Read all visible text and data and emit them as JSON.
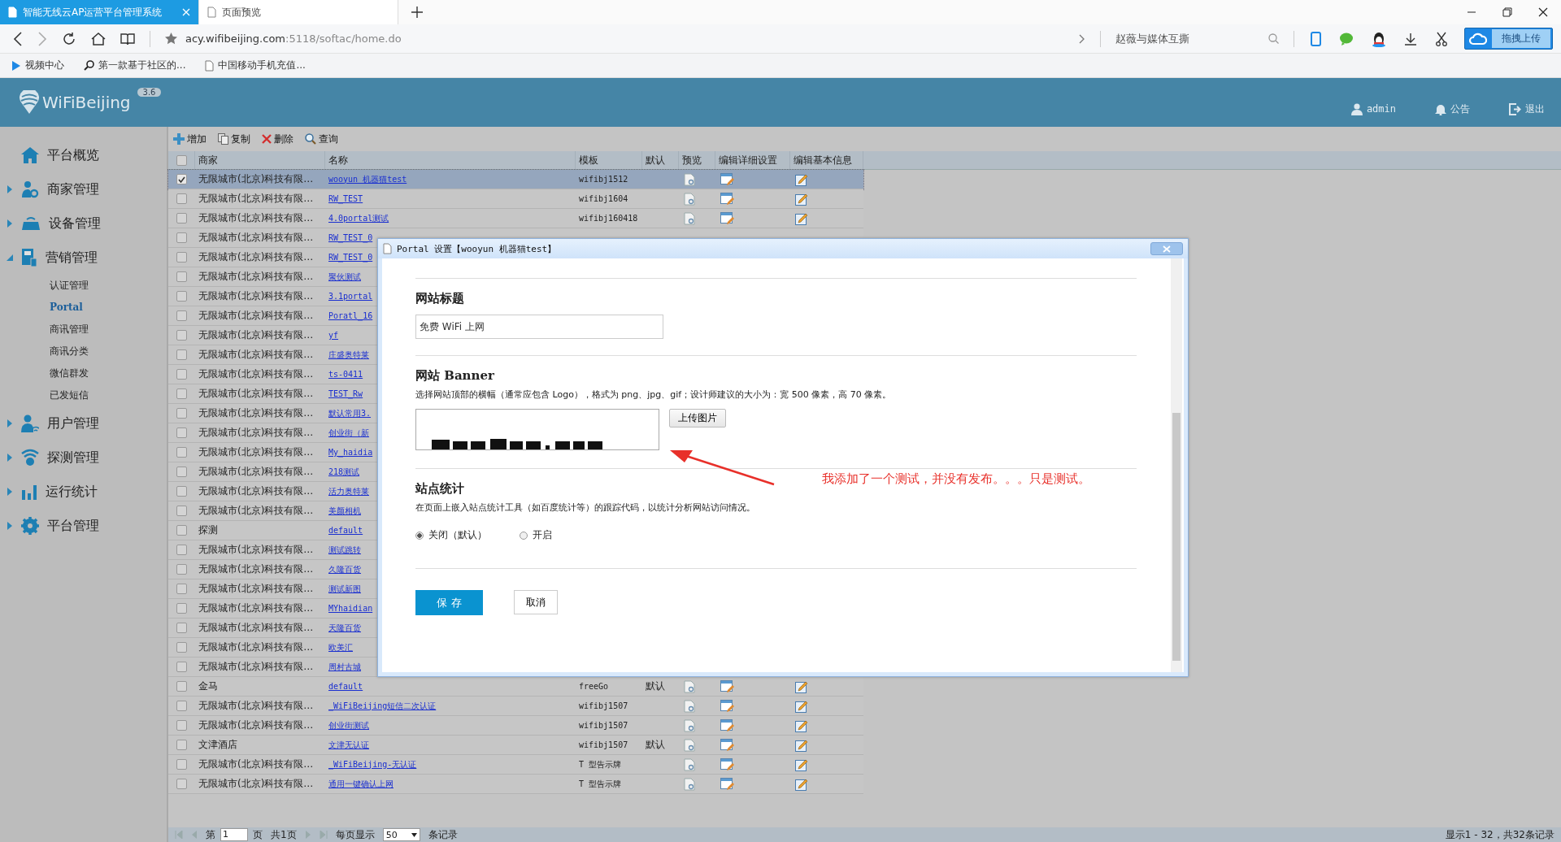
{
  "browser": {
    "tabs": [
      {
        "title": "智能无线云AP运营平台管理系统",
        "selected": true
      },
      {
        "title": "页面预览",
        "selected": false
      }
    ],
    "url_host": "acy.wifibeijing.com",
    "url_path": ":5118/softac/home.do",
    "search_text": "赵薇与媒体互撕",
    "upload_label": "拖拽上传",
    "bookmarks": [
      "视频中心",
      "第一款基于社区的...",
      "中国移动手机充值..."
    ]
  },
  "header": {
    "logo": "WiFiBeijing",
    "version": "3.6",
    "user": "admin",
    "notice": "公告",
    "logout": "退出"
  },
  "sidebar": {
    "items": [
      {
        "label": "平台概览"
      },
      {
        "label": "商家管理",
        "expanded": false
      },
      {
        "label": "设备管理",
        "expanded": false
      },
      {
        "label": "营销管理",
        "expanded": true,
        "children": [
          {
            "label": "认证管理",
            "selected": false
          },
          {
            "label": "Portal",
            "selected": true
          },
          {
            "label": "商讯管理",
            "selected": false
          },
          {
            "label": "商讯分类",
            "selected": false
          },
          {
            "label": "微信群发",
            "selected": false
          },
          {
            "label": "已发短信",
            "selected": false
          }
        ]
      },
      {
        "label": "用户管理",
        "expanded": false
      },
      {
        "label": "探测管理",
        "expanded": false
      },
      {
        "label": "运行统计",
        "expanded": false
      },
      {
        "label": "平台管理",
        "expanded": false
      }
    ]
  },
  "toolbar": [
    "增加",
    "复制",
    "删除",
    "查询"
  ],
  "table": {
    "select_all_checked": false,
    "columns": [
      "商家",
      "名称",
      "模板",
      "默认",
      "预览",
      "编辑详细设置",
      "编辑基本信息"
    ],
    "rows": [
      {
        "merchant": "无限城市(北京)科技有限…",
        "name": "wooyun 机器猫test",
        "template": "wifibj1512",
        "default": "",
        "checked": true,
        "selected": true
      },
      {
        "merchant": "无限城市(北京)科技有限…",
        "name": "RW_TEST",
        "template": "wifibj1604",
        "default": "",
        "checked": false,
        "selected": false
      },
      {
        "merchant": "无限城市(北京)科技有限…",
        "name": "4.0portal测试",
        "template": "wifibj160418",
        "default": "",
        "checked": false,
        "selected": false
      },
      {
        "merchant": "无限城市(北京)科技有限…",
        "name": "RW_TEST_0",
        "checked": false,
        "selected": false
      },
      {
        "merchant": "无限城市(北京)科技有限…",
        "name": "RW_TEST_0",
        "checked": false,
        "selected": false
      },
      {
        "merchant": "无限城市(北京)科技有限…",
        "name": "聚伙测试",
        "checked": false,
        "selected": false
      },
      {
        "merchant": "无限城市(北京)科技有限…",
        "name": "3.1portal",
        "checked": false,
        "selected": false
      },
      {
        "merchant": "无限城市(北京)科技有限…",
        "name": "Poratl_16",
        "checked": false,
        "selected": false
      },
      {
        "merchant": "无限城市(北京)科技有限…",
        "name": "yf",
        "checked": false,
        "selected": false
      },
      {
        "merchant": "无限城市(北京)科技有限…",
        "name": "庄盛奥特莱",
        "checked": false,
        "selected": false
      },
      {
        "merchant": "无限城市(北京)科技有限…",
        "name": "ts-0411",
        "checked": false,
        "selected": false
      },
      {
        "merchant": "无限城市(北京)科技有限…",
        "name": "TEST_Rw",
        "checked": false,
        "selected": false
      },
      {
        "merchant": "无限城市(北京)科技有限…",
        "name": "默认常用3.",
        "checked": false,
        "selected": false
      },
      {
        "merchant": "无限城市(北京)科技有限…",
        "name": "创业街（新",
        "checked": false,
        "selected": false
      },
      {
        "merchant": "无限城市(北京)科技有限…",
        "name": "My_haidia",
        "checked": false,
        "selected": false
      },
      {
        "merchant": "无限城市(北京)科技有限…",
        "name": "218测试",
        "checked": false,
        "selected": false
      },
      {
        "merchant": "无限城市(北京)科技有限…",
        "name": "活力奥特莱",
        "checked": false,
        "selected": false
      },
      {
        "merchant": "无限城市(北京)科技有限…",
        "name": "美颜相机",
        "checked": false,
        "selected": false
      },
      {
        "merchant": "探测",
        "name": "default",
        "checked": false,
        "selected": false
      },
      {
        "merchant": "无限城市(北京)科技有限…",
        "name": "测试跳转",
        "checked": false,
        "selected": false
      },
      {
        "merchant": "无限城市(北京)科技有限…",
        "name": "久隆百货",
        "checked": false,
        "selected": false
      },
      {
        "merchant": "无限城市(北京)科技有限…",
        "name": "测试新图",
        "checked": false,
        "selected": false
      },
      {
        "merchant": "无限城市(北京)科技有限…",
        "name": "MYhaidian",
        "checked": false,
        "selected": false
      },
      {
        "merchant": "无限城市(北京)科技有限…",
        "name": "天隆百货",
        "checked": false,
        "selected": false
      },
      {
        "merchant": "无限城市(北京)科技有限…",
        "name": "欧美汇",
        "checked": false,
        "selected": false
      },
      {
        "merchant": "无限城市(北京)科技有限…",
        "name": "周村古城",
        "checked": false,
        "selected": false
      },
      {
        "merchant": "金马",
        "name": "default",
        "template": "freeGo",
        "default": "默认",
        "checked": false,
        "selected": false
      },
      {
        "merchant": "无限城市(北京)科技有限…",
        "name": "_WiFiBeijing短信二次认证",
        "template": "wifibj1507",
        "default": "",
        "checked": false,
        "selected": false
      },
      {
        "merchant": "无限城市(北京)科技有限…",
        "name": "创业街测试",
        "template": "wifibj1507",
        "default": "",
        "checked": false,
        "selected": false
      },
      {
        "merchant": "文津酒店",
        "name": "文津无认证",
        "template": "wifibj1507",
        "default": "默认",
        "checked": false,
        "selected": false
      },
      {
        "merchant": "无限城市(北京)科技有限…",
        "name": "_WiFiBeijing-无认证",
        "template": "T 型告示牌",
        "default": "",
        "checked": false,
        "selected": false
      },
      {
        "merchant": "无限城市(北京)科技有限…",
        "name": "通用一键确认上网",
        "template": "T 型告示牌",
        "default": "",
        "checked": false,
        "selected": false
      }
    ]
  },
  "pager": {
    "page_prefix": "第",
    "page": "1",
    "page_suffix": "页",
    "total_pages": "共1页",
    "per_page_label": "每页显示",
    "per_page": "50",
    "per_page_suffix": "条记录",
    "summary": "显示1 - 32，共32条记录"
  },
  "dialog": {
    "title": "Portal 设置【wooyun 机器猫test】",
    "site_title": {
      "heading": "网站标题",
      "value": "免费 WiFi 上网"
    },
    "banner": {
      "heading": "网站 Banner",
      "description": "选择网站顶部的横幅（通常应包含 Logo），格式为 png、jpg、gif；设计师建议的大小为：宽 500 像素，高 70 像素。",
      "upload_button": "上传图片"
    },
    "stats": {
      "heading": "站点统计",
      "description": "在页面上嵌入站点统计工具（如百度统计等）的跟踪代码，以统计分析网站访问情况。",
      "options": [
        {
          "label": "关闭（默认）",
          "selected": true
        },
        {
          "label": "开启",
          "selected": false
        }
      ]
    },
    "save_button": "保 存",
    "cancel_button": "取消",
    "annotation": "我添加了一个测试，并没有发布。。。只是测试。"
  }
}
